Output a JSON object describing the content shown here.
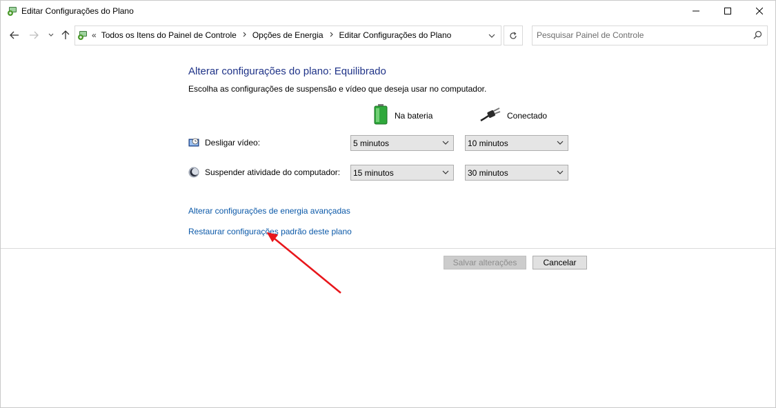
{
  "window": {
    "title": "Editar Configurações do Plano"
  },
  "addressbar": {
    "overflow": "«",
    "breadcrumbs": [
      "Todos os Itens do Painel de Controle",
      "Opções de Energia",
      "Editar Configurações do Plano"
    ]
  },
  "search": {
    "placeholder": "Pesquisar Painel de Controle"
  },
  "main": {
    "heading": "Alterar configurações do plano: Equilibrado",
    "subtext": "Escolha as configurações de suspensão e vídeo que deseja usar no computador.",
    "columns": {
      "battery": "Na bateria",
      "plugged": "Conectado"
    },
    "rows": [
      {
        "label": "Desligar vídeo:",
        "battery": "5 minutos",
        "plugged": "10 minutos"
      },
      {
        "label": "Suspender atividade do computador:",
        "battery": "15 minutos",
        "plugged": "30 minutos"
      }
    ],
    "links": {
      "advanced": "Alterar configurações de energia avançadas",
      "restore": "Restaurar configurações padrão deste plano"
    }
  },
  "buttons": {
    "save": "Salvar alterações",
    "cancel": "Cancelar"
  },
  "colors": {
    "heading": "#1e3287",
    "link": "#0a58a8",
    "annotation_arrow": "#e8161b"
  },
  "icons": [
    "power-options-icon",
    "battery-icon",
    "plug-icon",
    "display-clock-icon",
    "moon-sleep-icon",
    "search-icon",
    "refresh-icon"
  ]
}
